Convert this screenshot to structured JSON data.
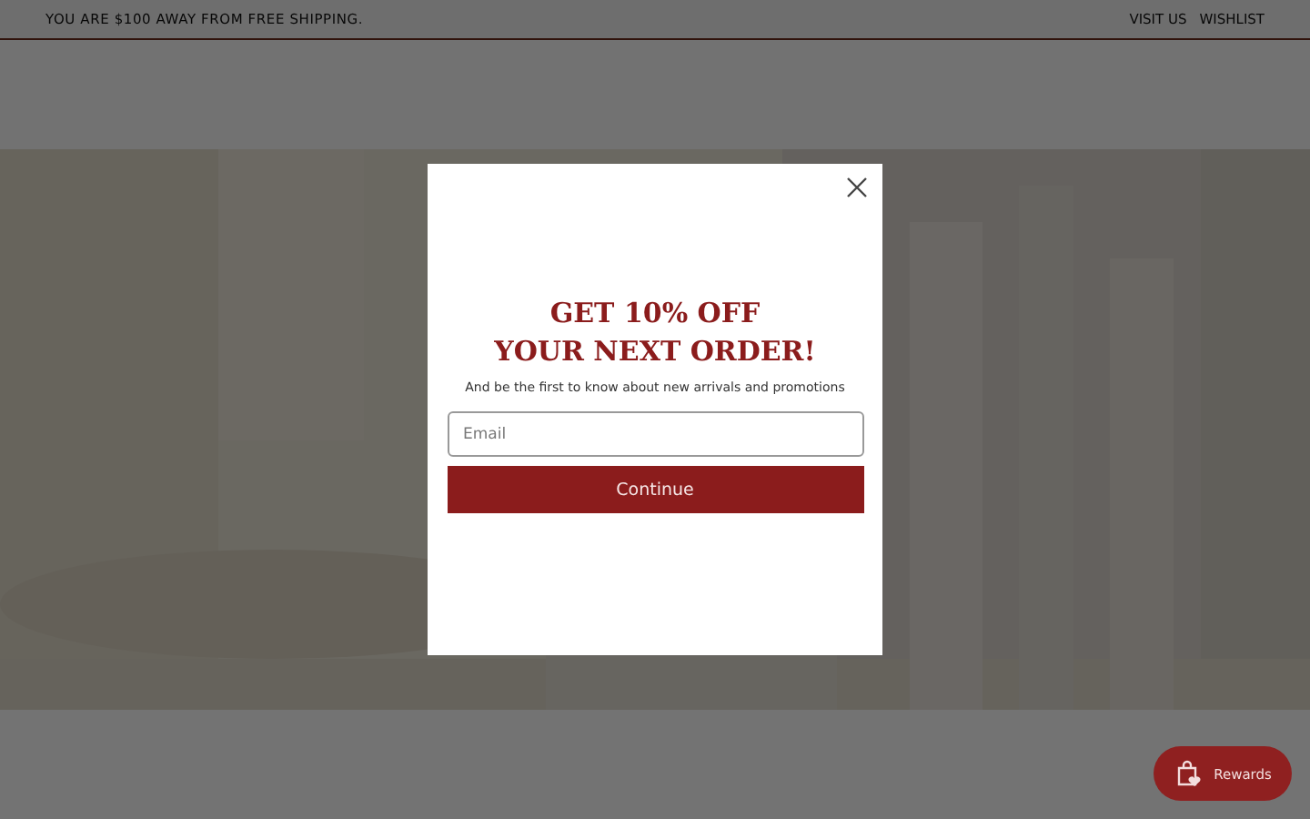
{
  "announcement": {
    "text": "YOU ARE $100 AWAY FROM FREE SHIPPING.",
    "links": [
      "VISIT US",
      "WISHLIST"
    ]
  },
  "popup": {
    "headline": [
      "GET 10% OFF",
      "YOUR NEXT ORDER!"
    ],
    "subtitle": "And be the first to know about new arrivals and promotions",
    "email": {
      "placeholder": "Email"
    },
    "button": "Continue"
  },
  "rewards": {
    "label": "Rewards"
  }
}
